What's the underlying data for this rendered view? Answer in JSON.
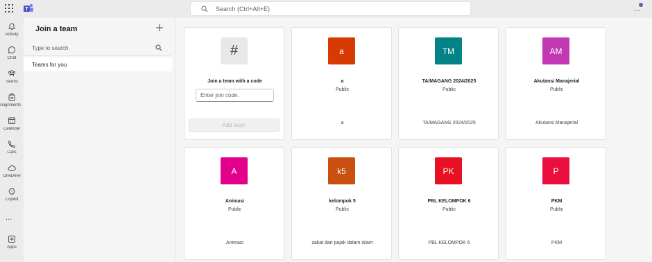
{
  "topbar": {
    "search_placeholder": "Search (Ctrl+Alt+E)",
    "more": "..."
  },
  "rail": {
    "items": [
      {
        "label": "Activity",
        "icon": "bell-icon"
      },
      {
        "label": "Chat",
        "icon": "chat-icon"
      },
      {
        "label": "Teams",
        "icon": "teams-icon"
      },
      {
        "label": "Assignments",
        "icon": "assignments-icon"
      },
      {
        "label": "Calendar",
        "icon": "calendar-icon"
      },
      {
        "label": "Calls",
        "icon": "phone-icon"
      },
      {
        "label": "OneDrive",
        "icon": "cloud-icon"
      },
      {
        "label": "Copilot",
        "icon": "copilot-icon"
      },
      {
        "label": "Apps",
        "icon": "apps-icon"
      }
    ],
    "more": "..."
  },
  "sidebar": {
    "title": "Join a team",
    "search_placeholder": "Type to search",
    "item": "Teams for you"
  },
  "join_card": {
    "symbol": "#",
    "title": "Join a team with a code",
    "input_placeholder": "Enter join code.",
    "button": "Add team"
  },
  "teams": [
    {
      "initials": "a",
      "name": "a",
      "visibility": "Public",
      "description": "a",
      "color": "#d83b01"
    },
    {
      "initials": "TM",
      "name": "TA/MAGANG 2024/2025",
      "visibility": "Public",
      "description": "TA/MAGANG 2024/2025",
      "color": "#038387"
    },
    {
      "initials": "AM",
      "name": "Akutansi Manajerial",
      "visibility": "Public",
      "description": "Akutansi Manajerial",
      "color": "#c239b3"
    },
    {
      "initials": "A",
      "name": "Animasi",
      "visibility": "Public",
      "description": "Animasi",
      "color": "#e3008c"
    },
    {
      "initials": "k5",
      "name": "kelompok 5",
      "visibility": "Public",
      "description": "zakat dan pajak dalam islam",
      "color": "#ca5010"
    },
    {
      "initials": "PK",
      "name": "PBL KELOMPOK 6",
      "visibility": "Public",
      "description": "PBL KELOMPOK 6",
      "color": "#e81123"
    },
    {
      "initials": "P",
      "name": "PKM",
      "visibility": "Public",
      "description": "PKM",
      "color": "#ea0f3f"
    }
  ]
}
